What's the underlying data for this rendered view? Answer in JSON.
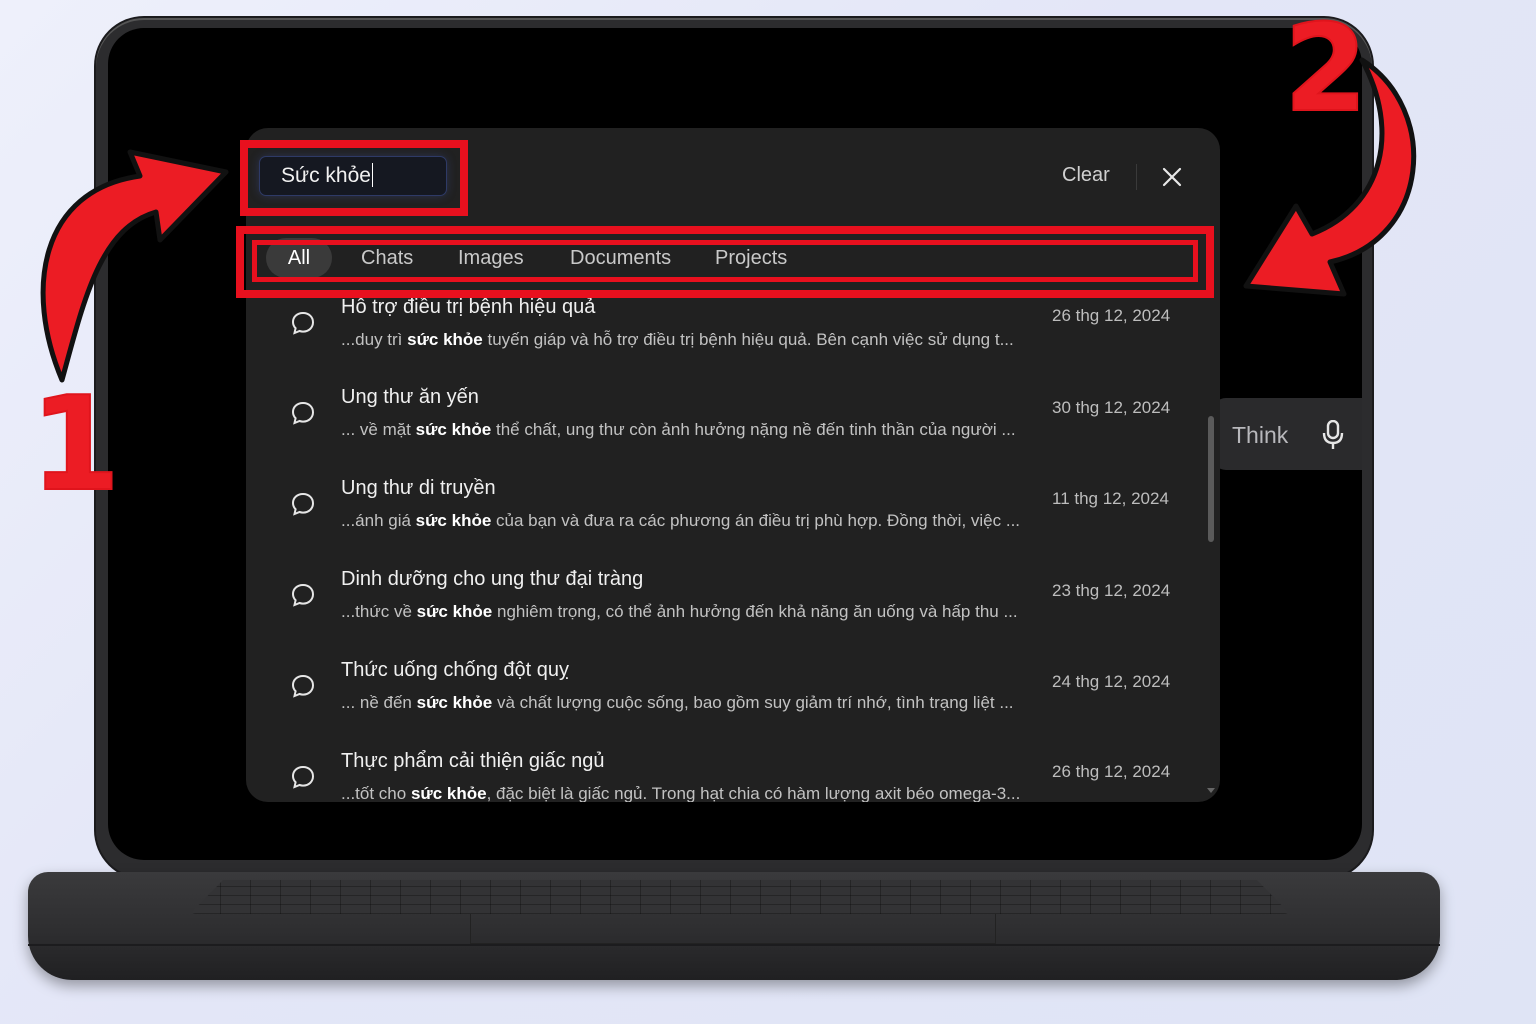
{
  "search": {
    "query": "Sức khỏe",
    "clear_label": "Clear"
  },
  "tabs": [
    {
      "label": "All",
      "active": true
    },
    {
      "label": "Chats",
      "active": false
    },
    {
      "label": "Images",
      "active": false
    },
    {
      "label": "Documents",
      "active": false
    },
    {
      "label": "Projects",
      "active": false
    }
  ],
  "results": [
    {
      "title": "Hỗ trợ điều trị bệnh hiệu quả",
      "pre": "...duy trì ",
      "keyword": "sức khỏe",
      "post": " tuyến giáp và hỗ trợ điều trị bệnh hiệu quả. Bên cạnh việc sử dụng t...",
      "date": "26 thg 12, 2024"
    },
    {
      "title": "Ung thư ăn yến",
      "pre": "... về mặt ",
      "keyword": "sức khỏe",
      "post": " thể chất, ung thư còn ảnh hưởng nặng nề đến tinh thần của người ...",
      "date": "30 thg 12, 2024"
    },
    {
      "title": "Ung thư di truyền",
      "pre": "...ánh giá ",
      "keyword": "sức khỏe",
      "post": " của bạn và đưa ra các phương án điều trị phù hợp. Đồng thời, việc ...",
      "date": "11 thg 12, 2024"
    },
    {
      "title": "Dinh dưỡng cho ung thư đại tràng",
      "pre": "...thức về ",
      "keyword": "sức khỏe",
      "post": " nghiêm trọng, có thể ảnh hưởng đến khả năng ăn uống và hấp thu ...",
      "date": "23 thg 12, 2024"
    },
    {
      "title": "Thức uống chống đột quỵ",
      "pre": "... nề đến ",
      "keyword": "sức khỏe",
      "post": " và chất lượng cuộc sống, bao gồm suy giảm trí nhớ, tình trạng liệt ...",
      "date": "24 thg 12, 2024"
    },
    {
      "title": "Thực phẩm cải thiện giấc ngủ",
      "pre": "...tốt cho ",
      "keyword": "sức khỏe",
      "post": ", đặc biệt là giấc ngủ. Trong hạt chia có hàm lượng axit béo omega-3...",
      "date": "26 thg 12, 2024"
    }
  ],
  "composer": {
    "think_label": "Think"
  },
  "annotations": {
    "step1": "1",
    "step2": "2",
    "color": "#e8101e"
  },
  "icons": {
    "result": "chat-bubble-icon",
    "close": "close-icon",
    "mic": "microphone-icon"
  }
}
